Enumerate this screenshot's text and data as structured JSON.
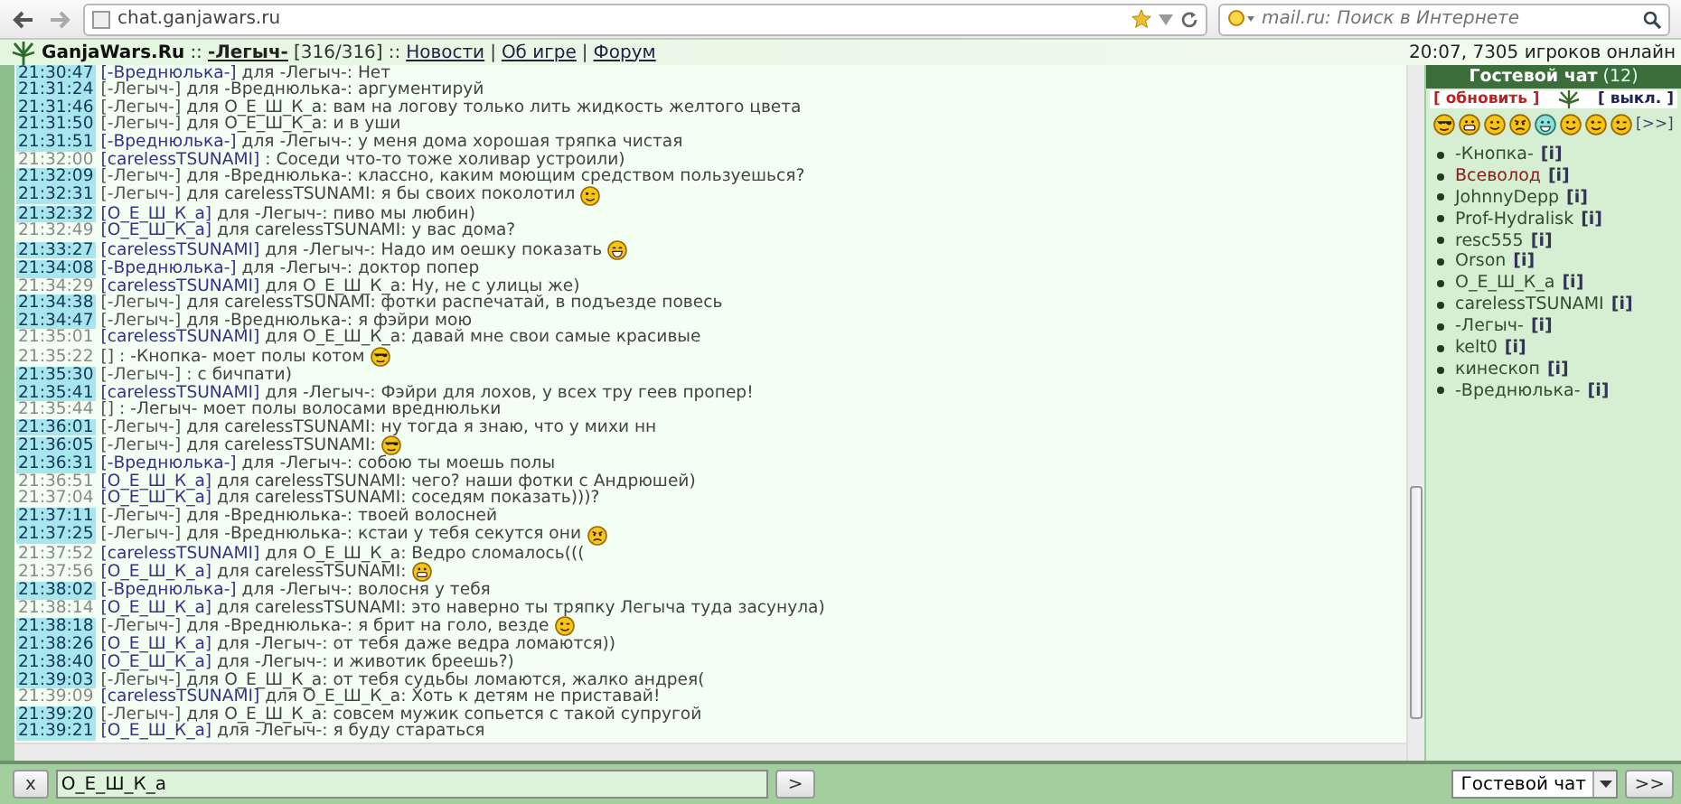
{
  "browser": {
    "url": "chat.ganjawars.ru",
    "search_placeholder": "mail.ru: Поиск в Интернете"
  },
  "header": {
    "items": [
      {
        "kind": "site",
        "text": "GanjaWars.Ru"
      },
      {
        "kind": "text",
        "text": "::"
      },
      {
        "kind": "user",
        "text": "-Легыч-"
      },
      {
        "kind": "text",
        "text": "[316/316]"
      },
      {
        "kind": "text",
        "text": "::"
      },
      {
        "kind": "link",
        "text": "Новости"
      },
      {
        "kind": "text",
        "text": "|"
      },
      {
        "kind": "link",
        "text": "Об игре"
      },
      {
        "kind": "text",
        "text": "|"
      },
      {
        "kind": "link",
        "text": "Форум"
      }
    ],
    "status": "20:07, 7305 игроков онлайн"
  },
  "messages": [
    {
      "time": "21:30:47",
      "highlighted": true,
      "author": "[-Вреднюлька-]",
      "color": "#333388",
      "text": "для -Легыч-: Нет"
    },
    {
      "time": "21:31:24",
      "highlighted": true,
      "author": "[-Легыч-]",
      "color": "#555555",
      "text": "для -Вреднюлька-: аргументируй"
    },
    {
      "time": "21:31:46",
      "highlighted": true,
      "author": "[-Легыч-]",
      "color": "#555555",
      "text": "для О_Е_Ш_К_а: вам на логову только лить жидкость желтого цвета"
    },
    {
      "time": "21:31:50",
      "highlighted": true,
      "author": "[-Легыч-]",
      "color": "#555555",
      "text": "для О_Е_Ш_К_а: и в уши"
    },
    {
      "time": "21:31:51",
      "highlighted": true,
      "author": "[-Вреднюлька-]",
      "color": "#333388",
      "text": "для -Легыч-: у меня дома хорошая тряпка чистая"
    },
    {
      "time": "21:32:00",
      "highlighted": false,
      "author": "[carelessTSUNAMI]",
      "color": "#333388",
      "text": ": Соседи что-то тоже холивар устроили)"
    },
    {
      "time": "21:32:09",
      "highlighted": true,
      "author": "[-Легыч-]",
      "color": "#555555",
      "text": "для -Вреднюлька-: классно, каким моющим средством пользуешься?"
    },
    {
      "time": "21:32:31",
      "highlighted": true,
      "author": "[-Легыч-]",
      "color": "#555555",
      "text": "для carelessTSUNAMI: я бы своих поколотил",
      "smiley": {
        "kind": "wink"
      }
    },
    {
      "time": "21:32:32",
      "highlighted": true,
      "author": "[О_Е_Ш_К_а]",
      "color": "#333388",
      "text": "для -Легыч-: пиво мы любин)"
    },
    {
      "time": "21:32:49",
      "highlighted": false,
      "author": "[О_Е_Ш_К_а]",
      "color": "#333388",
      "text": "для carelessTSUNAMI: у вас дома?"
    },
    {
      "time": "21:33:27",
      "highlighted": true,
      "author": "[carelessTSUNAMI]",
      "color": "#333388",
      "text": "для -Легыч-: Надо им оешку показать",
      "smiley": {
        "kind": "laugh"
      }
    },
    {
      "time": "21:34:08",
      "highlighted": true,
      "author": "[-Вреднюлька-]",
      "color": "#333388",
      "text": "для -Легыч-: доктор попер"
    },
    {
      "time": "21:34:29",
      "highlighted": false,
      "author": "[carelessTSUNAMI]",
      "color": "#333388",
      "text": "для О_Е_Ш_К_а: Ну, не с улицы же)"
    },
    {
      "time": "21:34:38",
      "highlighted": true,
      "author": "[-Легыч-]",
      "color": "#555555",
      "text": "для carelessTSUNAMI: фотки распечатай, в подъезде повесь"
    },
    {
      "time": "21:34:47",
      "highlighted": true,
      "author": "[-Легыч-]",
      "color": "#555555",
      "text": "для -Вреднюлька-: я фэйри мою"
    },
    {
      "time": "21:35:01",
      "highlighted": false,
      "author": "[carelessTSUNAMI]",
      "color": "#333388",
      "text": "для О_Е_Ш_К_а: давай мне свои самые красивые"
    },
    {
      "time": "21:35:22",
      "highlighted": false,
      "author": "[]",
      "color": "#555555",
      "text": ": -Кнопка- моет полы котом",
      "smiley": {
        "kind": "cool"
      }
    },
    {
      "time": "21:35:30",
      "highlighted": true,
      "author": "[-Легыч-]",
      "color": "#555555",
      "text": ": с бичпати)"
    },
    {
      "time": "21:35:41",
      "highlighted": true,
      "author": "[carelessTSUNAMI]",
      "color": "#333388",
      "text": "для -Легыч-: Фэйри для лохов, у всех тру геев пропер!"
    },
    {
      "time": "21:35:44",
      "highlighted": false,
      "author": "[]",
      "color": "#555555",
      "text": ": -Легыч- моет полы волосами вреднюльки"
    },
    {
      "time": "21:36:01",
      "highlighted": true,
      "author": "[-Легыч-]",
      "color": "#555555",
      "text": "для carelessTSUNAMI: ну тогда я знаю, что у михи нн"
    },
    {
      "time": "21:36:05",
      "highlighted": true,
      "author": "[-Легыч-]",
      "color": "#555555",
      "text": "для carelessTSUNAMI:",
      "smiley": {
        "kind": "cool"
      }
    },
    {
      "time": "21:36:31",
      "highlighted": true,
      "author": "[-Вреднюлька-]",
      "color": "#333388",
      "text": "для -Легыч-: собою ты моешь полы"
    },
    {
      "time": "21:36:51",
      "highlighted": false,
      "author": "[О_Е_Ш_К_а]",
      "color": "#333388",
      "text": "для carelessTSUNAMI: чего? наши фотки с Андрюшей)"
    },
    {
      "time": "21:37:04",
      "highlighted": false,
      "author": "[О_Е_Ш_К_а]",
      "color": "#333388",
      "text": "для carelessTSUNAMI: соседям показать)))?"
    },
    {
      "time": "21:37:11",
      "highlighted": true,
      "author": "[-Легыч-]",
      "color": "#555555",
      "text": "для -Вреднюлька-: твоей волосней"
    },
    {
      "time": "21:37:25",
      "highlighted": true,
      "author": "[-Легыч-]",
      "color": "#555555",
      "text": "для -Вреднюлька-: кстаи у тебя секутся они",
      "smiley": {
        "kind": "angry"
      }
    },
    {
      "time": "21:37:52",
      "highlighted": false,
      "author": "[carelessTSUNAMI]",
      "color": "#333388",
      "text": "для О_Е_Ш_К_а: Ведро сломалось((("
    },
    {
      "time": "21:37:56",
      "highlighted": false,
      "author": "[О_Е_Ш_К_а]",
      "color": "#333388",
      "text": "для carelessTSUNAMI:",
      "smiley": {
        "kind": "grin"
      }
    },
    {
      "time": "21:38:02",
      "highlighted": true,
      "author": "[-Вреднюлька-]",
      "color": "#333388",
      "text": "для -Легыч-: волосня у тебя"
    },
    {
      "time": "21:38:14",
      "highlighted": false,
      "author": "[О_Е_Ш_К_а]",
      "color": "#333388",
      "text": "для carelessTSUNAMI: это наверно ты тряпку Легыча туда засунула)"
    },
    {
      "time": "21:38:18",
      "highlighted": true,
      "author": "[-Легыч-]",
      "color": "#555555",
      "text": "для -Вреднюлька-: я брит на голо, везде",
      "smiley": {
        "kind": "wink"
      }
    },
    {
      "time": "21:38:26",
      "highlighted": true,
      "author": "[О_Е_Ш_К_а]",
      "color": "#333388",
      "text": "для -Легыч-: от тебя даже ведра ломаются))"
    },
    {
      "time": "21:38:40",
      "highlighted": true,
      "author": "[О_Е_Ш_К_а]",
      "color": "#333388",
      "text": "для -Легыч-: и животик бреешь?)"
    },
    {
      "time": "21:39:03",
      "highlighted": true,
      "author": "[-Легыч-]",
      "color": "#555555",
      "text": "для О_Е_Ш_К_а: от тебя судьбы ломаются, жалко андрея("
    },
    {
      "time": "21:39:09",
      "highlighted": false,
      "author": "[carelessTSUNAMI]",
      "color": "#333388",
      "text": "для О_Е_Ш_К_а: Хоть к детям не приставай!"
    },
    {
      "time": "21:39:20",
      "highlighted": true,
      "author": "[-Легыч-]",
      "color": "#555555",
      "text": "для О_Е_Ш_К_а: совсем мужик сопьется с такой супругой"
    },
    {
      "time": "21:39:21",
      "highlighted": true,
      "author": "[О_Е_Ш_К_а]",
      "color": "#333388",
      "text": "для -Легыч-: я буду стараться"
    }
  ],
  "panel": {
    "title": "Гостевой чат",
    "count": "(12)",
    "refresh": "[ обновить ]",
    "off": "[ выкл. ]",
    "smileys": [
      {
        "kind": "cool"
      },
      {
        "kind": "grin"
      },
      {
        "kind": "smile"
      },
      {
        "kind": "angry"
      },
      {
        "kind": "teeth"
      },
      {
        "kind": "smile"
      },
      {
        "kind": "wink"
      },
      {
        "kind": "wink"
      }
    ],
    "more": "[>>]",
    "users": [
      {
        "name": "-Кнопка-",
        "color": "#2f4f2f",
        "info": "[i]"
      },
      {
        "name": "Всеволод",
        "color": "#8b1a1a",
        "info": "[i]"
      },
      {
        "name": "JohnnyDepp",
        "color": "#2f4f2f",
        "info": "[i]"
      },
      {
        "name": "Prof-Hydralisk",
        "color": "#2f4f2f",
        "info": "[i]"
      },
      {
        "name": "resc555",
        "color": "#2f4f2f",
        "info": "[i]"
      },
      {
        "name": "Orson",
        "color": "#2f4f2f",
        "info": "[i]"
      },
      {
        "name": "О_Е_Ш_К_а",
        "color": "#2f4f2f",
        "info": "[i]"
      },
      {
        "name": "carelessTSUNAMI",
        "color": "#2f4f2f",
        "info": "[i]"
      },
      {
        "name": "-Легыч-",
        "color": "#2f4f2f",
        "info": "[i]"
      },
      {
        "name": "kelt0",
        "color": "#2f4f2f",
        "info": "[i]"
      },
      {
        "name": "кинескоп",
        "color": "#2f4f2f",
        "info": "[i]"
      },
      {
        "name": "-Вреднюлька-",
        "color": "#2f4f2f",
        "info": "[i]"
      }
    ]
  },
  "input_bar": {
    "clear": "x",
    "value": "О_Е_Ш_К_а",
    "send": ">",
    "channel": "Гостевой чат",
    "go": ">>"
  }
}
